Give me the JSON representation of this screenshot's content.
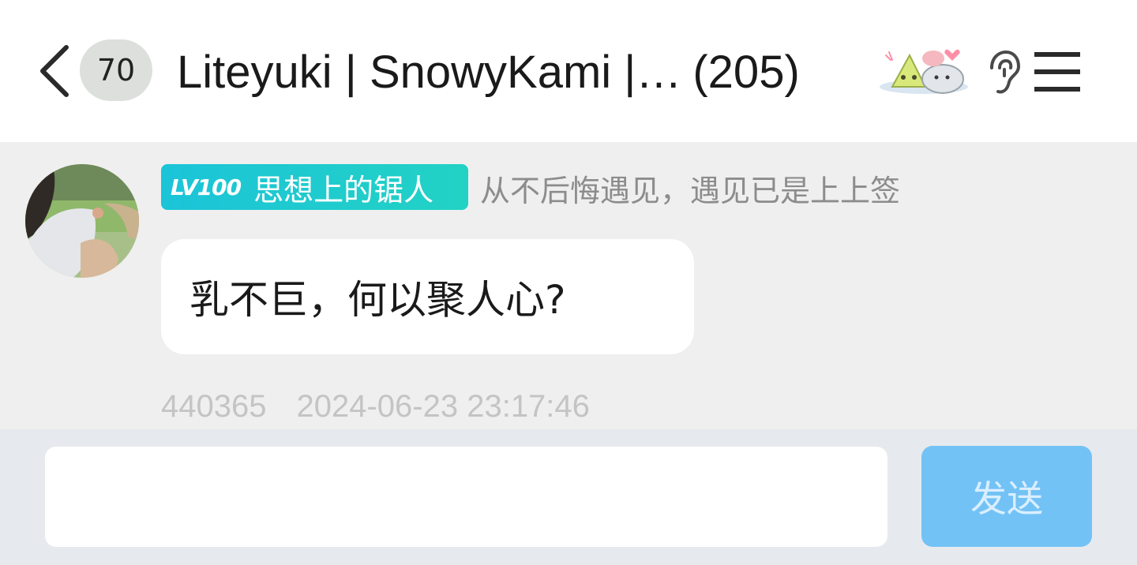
{
  "header": {
    "unread_count": "70",
    "group_name": "Liteyuki | SnowyKami |…",
    "member_count": "(205)"
  },
  "icons": {
    "back": "chevron-left-icon",
    "sticker": "rice-dumpling-sticker-icon",
    "ear": "ear-icon",
    "menu": "hamburger-menu-icon"
  },
  "message": {
    "level": "LV100",
    "sender_title": "思想上的锯人",
    "signature": "从不后悔遇见，遇见已是上上签",
    "text": "乳不巨，何以聚人心?",
    "sender_id": "440365",
    "timestamp": "2024-06-23 23:17:46"
  },
  "composer": {
    "send_label": "发送",
    "input_value": ""
  },
  "colors": {
    "chat_background": "#efefef",
    "level_tag": "#1cc4d8",
    "send_button": "#73c2f5"
  }
}
